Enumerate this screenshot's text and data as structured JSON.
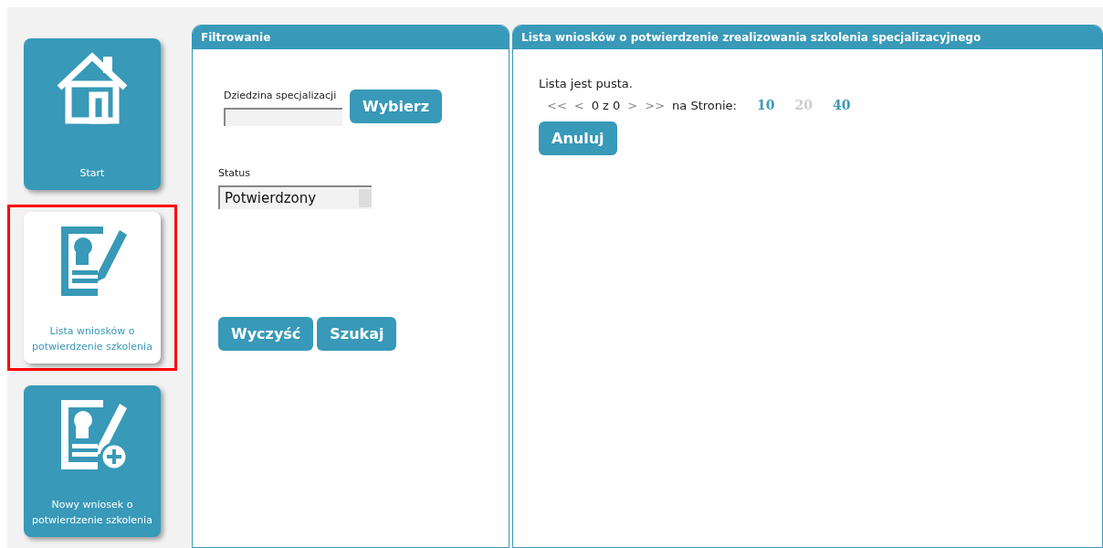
{
  "sidebar": {
    "items": [
      {
        "label": "Start",
        "kind": "house",
        "selected": false,
        "highlighted": false
      },
      {
        "label": "Lista wniosków o potwierdzenie szkolenia",
        "kind": "form",
        "selected": true,
        "highlighted": true
      },
      {
        "label": "Nowy wniosek o potwierdzenie szkolenia",
        "kind": "form-add",
        "selected": false,
        "highlighted": false
      }
    ]
  },
  "filter_panel": {
    "title": "Filtrowanie",
    "field_label": "Dziedzina specjalizacji",
    "choose_button": "Wybierz",
    "status_label": "Status",
    "status_value": "Potwierdzony",
    "buttons": [
      "Wyczyść",
      "Szukaj"
    ]
  },
  "list_panel": {
    "title": "Lista wniosków o potwierdzenie zrealizowania szkolenia specjalizacyjnego",
    "empty_text": "Lista jest pusta.",
    "pager": {
      "first": "<<",
      "prev": "<",
      "position": "0 z 0",
      "next": ">",
      "last": ">>",
      "per_page_label": "na Stronie:",
      "page_sizes": [
        {
          "label": "10",
          "selected": false
        },
        {
          "label": "20",
          "selected": true
        },
        {
          "label": "40",
          "selected": false
        }
      ]
    },
    "cancel_button": "Anuluj"
  }
}
